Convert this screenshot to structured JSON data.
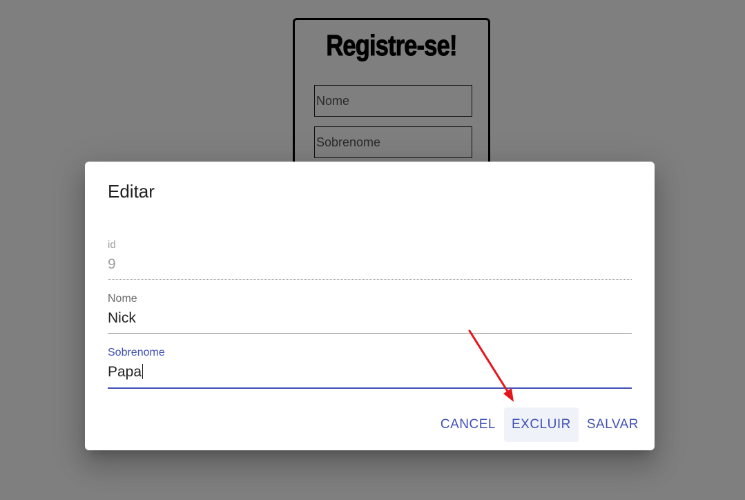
{
  "background_form": {
    "title": "Registre-se!",
    "nome_placeholder": "Nome",
    "sobrenome_placeholder": "Sobrenome"
  },
  "dialog": {
    "title": "Editar",
    "fields": {
      "id": {
        "label": "id",
        "value": "9"
      },
      "nome": {
        "label": "Nome",
        "value": "Nick"
      },
      "sobrenome": {
        "label": "Sobrenome",
        "value": "Papa"
      }
    },
    "actions": {
      "cancel_label": "Cancel",
      "excluir_label": "Excluir",
      "salvar_label": "Salvar"
    }
  },
  "colors": {
    "accent": "#3f51b5",
    "annotation_arrow": "#e8141b",
    "overlay": "rgba(0,0,0,0.5)"
  }
}
